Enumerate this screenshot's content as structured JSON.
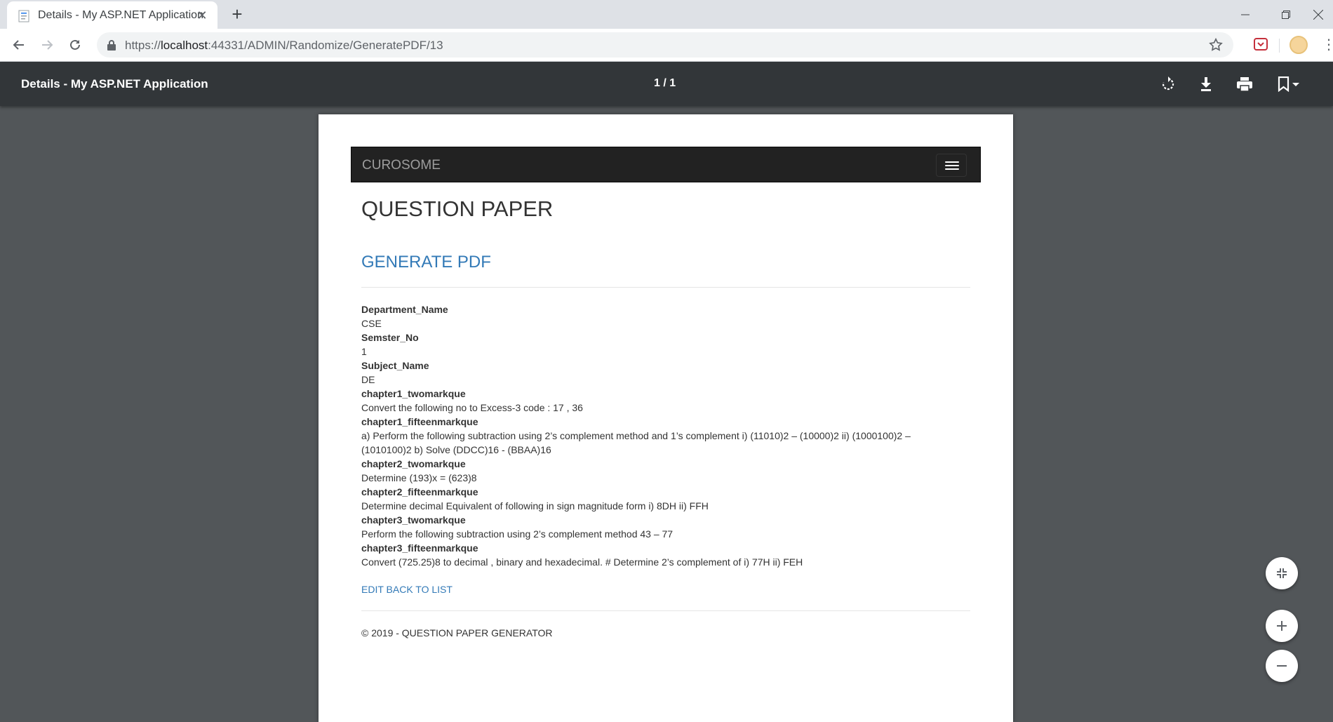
{
  "tab": {
    "title": "Details - My ASP.NET Application"
  },
  "address_bar": {
    "url_scheme": "https://",
    "url_host": "localhost",
    "url_rest": ":44331/ADMIN/Randomize/GeneratePDF/13"
  },
  "pdf_toolbar": {
    "title": "Details - My ASP.NET Application",
    "page_indicator": "1 / 1"
  },
  "document": {
    "navbar_brand": "CUROSOME",
    "heading": "QUESTION PAPER",
    "subheading": "GENERATE PDF",
    "fields": [
      {
        "term": "Department_Name",
        "value": "CSE"
      },
      {
        "term": "Semster_No",
        "value": "1"
      },
      {
        "term": "Subject_Name",
        "value": "DE"
      },
      {
        "term": "chapter1_twomarkque",
        "value": "Convert the following no to Excess-3 code : 17 , 36"
      },
      {
        "term": "chapter1_fifteenmarkque",
        "value": "a) Perform the following subtraction using 2’s complement method and 1’s complement i) (11010)2 – (10000)2 ii) (1000100)2 – (1010100)2 b) Solve (DDCC)16 - (BBAA)16"
      },
      {
        "term": "chapter2_twomarkque",
        "value": "Determine (193)x = (623)8"
      },
      {
        "term": "chapter2_fifteenmarkque",
        "value": "Determine decimal Equivalent of following in sign magnitude form i) 8DH ii) FFH"
      },
      {
        "term": "chapter3_twomarkque",
        "value": "Perform the following subtraction using 2’s complement method 43 – 77"
      },
      {
        "term": "chapter3_fifteenmarkque",
        "value": "Convert (725.25)8 to decimal , binary and hexadecimal. # Determine 2’s complement of i) 77H ii) FEH"
      }
    ],
    "back_link": "EDIT BACK TO LIST",
    "footer": "© 2019 - QUESTION PAPER GENERATOR"
  },
  "colors": {
    "link": "#337ab7",
    "navbar": "#222222",
    "viewer_bg": "#525659",
    "viewer_toolbar": "#323639"
  },
  "icons": [
    "back-icon",
    "forward-icon",
    "reload-icon",
    "lock-icon",
    "star-icon",
    "rotate-icon",
    "download-icon",
    "print-icon",
    "bookmark-icon",
    "fit-page-icon",
    "zoom-in-icon",
    "zoom-out-icon"
  ]
}
